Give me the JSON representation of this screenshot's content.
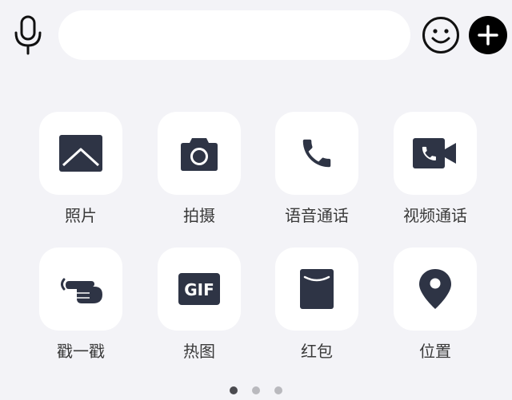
{
  "input": {
    "value": "",
    "placeholder": ""
  },
  "toolbar": {
    "voice_icon": "microphone-icon",
    "emoji_icon": "smiley-icon",
    "more_icon": "plus-icon"
  },
  "panel": {
    "items": [
      {
        "label": "照片",
        "icon": "photo-icon"
      },
      {
        "label": "拍摄",
        "icon": "camera-icon"
      },
      {
        "label": "语音通话",
        "icon": "phone-icon"
      },
      {
        "label": "视频通话",
        "icon": "video-call-icon"
      },
      {
        "label": "戳一戳",
        "icon": "pointing-hand-icon"
      },
      {
        "label": "热图",
        "icon": "gif-icon"
      },
      {
        "label": "红包",
        "icon": "red-packet-icon"
      },
      {
        "label": "位置",
        "icon": "location-pin-icon"
      }
    ]
  },
  "pager": {
    "pages": 3,
    "active_page": 1
  },
  "colors": {
    "background": "#f3f3f7",
    "tile": "#ffffff",
    "icon": "#2e3445",
    "plus_button": "#000000"
  }
}
